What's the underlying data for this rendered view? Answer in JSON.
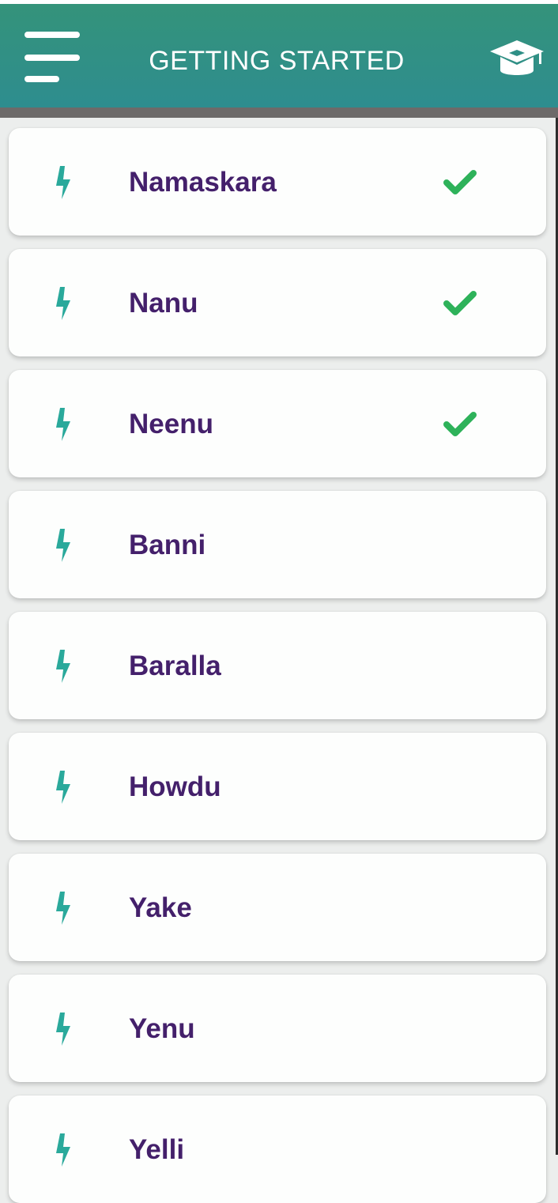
{
  "header": {
    "title": "GETTING STARTED",
    "menu_icon": "hamburger-menu-icon",
    "right_icon": "graduation-cap-icon",
    "background_color": "#34937a",
    "title_color": "#ffffff"
  },
  "lessons": {
    "accent_icon": "lightning-bolt-icon",
    "accent_color": "#2aa99b",
    "text_color": "#44206b",
    "check_icon": "checkmark-icon",
    "check_color": "#2eb25a",
    "items": [
      {
        "label": "Namaskara",
        "completed": true
      },
      {
        "label": "Nanu",
        "completed": true
      },
      {
        "label": "Neenu",
        "completed": true
      },
      {
        "label": "Banni",
        "completed": false
      },
      {
        "label": "Baralla",
        "completed": false
      },
      {
        "label": "Howdu",
        "completed": false
      },
      {
        "label": "Yake",
        "completed": false
      },
      {
        "label": "Yenu",
        "completed": false
      },
      {
        "label": "Yelli",
        "completed": false
      }
    ]
  }
}
